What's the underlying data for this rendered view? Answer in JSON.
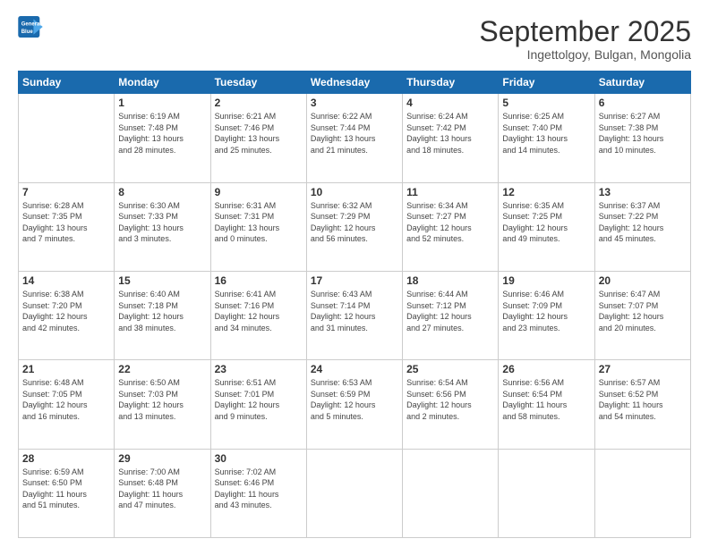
{
  "header": {
    "logo_line1": "General",
    "logo_line2": "Blue",
    "main_title": "September 2025",
    "subtitle": "Ingettolgoy, Bulgan, Mongolia"
  },
  "days_of_week": [
    "Sunday",
    "Monday",
    "Tuesday",
    "Wednesday",
    "Thursday",
    "Friday",
    "Saturday"
  ],
  "weeks": [
    [
      {
        "day": "",
        "content": ""
      },
      {
        "day": "1",
        "content": "Sunrise: 6:19 AM\nSunset: 7:48 PM\nDaylight: 13 hours\nand 28 minutes."
      },
      {
        "day": "2",
        "content": "Sunrise: 6:21 AM\nSunset: 7:46 PM\nDaylight: 13 hours\nand 25 minutes."
      },
      {
        "day": "3",
        "content": "Sunrise: 6:22 AM\nSunset: 7:44 PM\nDaylight: 13 hours\nand 21 minutes."
      },
      {
        "day": "4",
        "content": "Sunrise: 6:24 AM\nSunset: 7:42 PM\nDaylight: 13 hours\nand 18 minutes."
      },
      {
        "day": "5",
        "content": "Sunrise: 6:25 AM\nSunset: 7:40 PM\nDaylight: 13 hours\nand 14 minutes."
      },
      {
        "day": "6",
        "content": "Sunrise: 6:27 AM\nSunset: 7:38 PM\nDaylight: 13 hours\nand 10 minutes."
      }
    ],
    [
      {
        "day": "7",
        "content": "Sunrise: 6:28 AM\nSunset: 7:35 PM\nDaylight: 13 hours\nand 7 minutes."
      },
      {
        "day": "8",
        "content": "Sunrise: 6:30 AM\nSunset: 7:33 PM\nDaylight: 13 hours\nand 3 minutes."
      },
      {
        "day": "9",
        "content": "Sunrise: 6:31 AM\nSunset: 7:31 PM\nDaylight: 13 hours\nand 0 minutes."
      },
      {
        "day": "10",
        "content": "Sunrise: 6:32 AM\nSunset: 7:29 PM\nDaylight: 12 hours\nand 56 minutes."
      },
      {
        "day": "11",
        "content": "Sunrise: 6:34 AM\nSunset: 7:27 PM\nDaylight: 12 hours\nand 52 minutes."
      },
      {
        "day": "12",
        "content": "Sunrise: 6:35 AM\nSunset: 7:25 PM\nDaylight: 12 hours\nand 49 minutes."
      },
      {
        "day": "13",
        "content": "Sunrise: 6:37 AM\nSunset: 7:22 PM\nDaylight: 12 hours\nand 45 minutes."
      }
    ],
    [
      {
        "day": "14",
        "content": "Sunrise: 6:38 AM\nSunset: 7:20 PM\nDaylight: 12 hours\nand 42 minutes."
      },
      {
        "day": "15",
        "content": "Sunrise: 6:40 AM\nSunset: 7:18 PM\nDaylight: 12 hours\nand 38 minutes."
      },
      {
        "day": "16",
        "content": "Sunrise: 6:41 AM\nSunset: 7:16 PM\nDaylight: 12 hours\nand 34 minutes."
      },
      {
        "day": "17",
        "content": "Sunrise: 6:43 AM\nSunset: 7:14 PM\nDaylight: 12 hours\nand 31 minutes."
      },
      {
        "day": "18",
        "content": "Sunrise: 6:44 AM\nSunset: 7:12 PM\nDaylight: 12 hours\nand 27 minutes."
      },
      {
        "day": "19",
        "content": "Sunrise: 6:46 AM\nSunset: 7:09 PM\nDaylight: 12 hours\nand 23 minutes."
      },
      {
        "day": "20",
        "content": "Sunrise: 6:47 AM\nSunset: 7:07 PM\nDaylight: 12 hours\nand 20 minutes."
      }
    ],
    [
      {
        "day": "21",
        "content": "Sunrise: 6:48 AM\nSunset: 7:05 PM\nDaylight: 12 hours\nand 16 minutes."
      },
      {
        "day": "22",
        "content": "Sunrise: 6:50 AM\nSunset: 7:03 PM\nDaylight: 12 hours\nand 13 minutes."
      },
      {
        "day": "23",
        "content": "Sunrise: 6:51 AM\nSunset: 7:01 PM\nDaylight: 12 hours\nand 9 minutes."
      },
      {
        "day": "24",
        "content": "Sunrise: 6:53 AM\nSunset: 6:59 PM\nDaylight: 12 hours\nand 5 minutes."
      },
      {
        "day": "25",
        "content": "Sunrise: 6:54 AM\nSunset: 6:56 PM\nDaylight: 12 hours\nand 2 minutes."
      },
      {
        "day": "26",
        "content": "Sunrise: 6:56 AM\nSunset: 6:54 PM\nDaylight: 11 hours\nand 58 minutes."
      },
      {
        "day": "27",
        "content": "Sunrise: 6:57 AM\nSunset: 6:52 PM\nDaylight: 11 hours\nand 54 minutes."
      }
    ],
    [
      {
        "day": "28",
        "content": "Sunrise: 6:59 AM\nSunset: 6:50 PM\nDaylight: 11 hours\nand 51 minutes."
      },
      {
        "day": "29",
        "content": "Sunrise: 7:00 AM\nSunset: 6:48 PM\nDaylight: 11 hours\nand 47 minutes."
      },
      {
        "day": "30",
        "content": "Sunrise: 7:02 AM\nSunset: 6:46 PM\nDaylight: 11 hours\nand 43 minutes."
      },
      {
        "day": "",
        "content": ""
      },
      {
        "day": "",
        "content": ""
      },
      {
        "day": "",
        "content": ""
      },
      {
        "day": "",
        "content": ""
      }
    ]
  ]
}
